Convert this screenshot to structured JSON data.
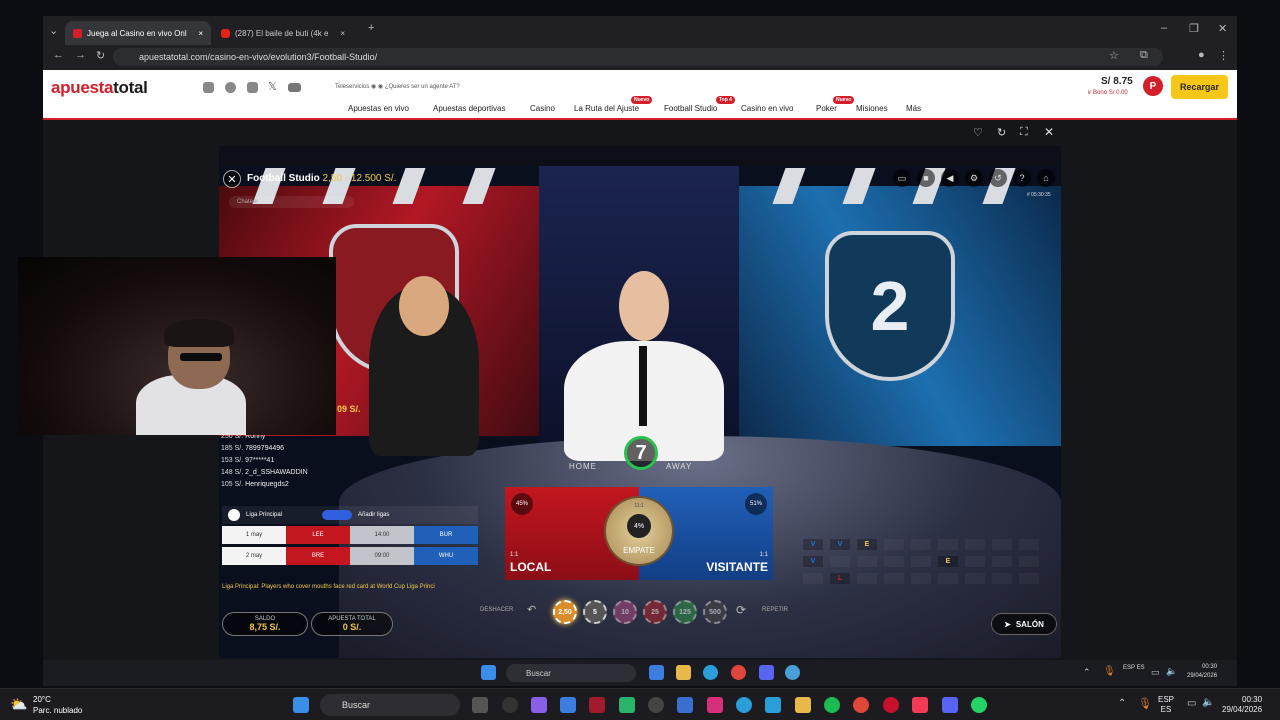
{
  "browser": {
    "tabs": [
      {
        "label": "Juega al Casino en vivo Onl"
      },
      {
        "label": "(287) El baile de buti (4k e"
      }
    ],
    "url": "apuestatotal.com/casino-en-vivo/evolution3/Football-Studio/"
  },
  "site": {
    "logo_part1": "apuesta",
    "logo_part2": "total",
    "service_line": "Teleservicios  ◉ ◉  ¿Quieres ser un agente AT?",
    "nav": [
      {
        "label": "Apuestas en vivo"
      },
      {
        "label": "Apuestas deportivas"
      },
      {
        "label": "Casino"
      },
      {
        "label": "La Ruta del Ajuste",
        "badge": "Nuevo"
      },
      {
        "label": "Football Studio",
        "badge": "Top 4"
      },
      {
        "label": "Casino en vivo"
      },
      {
        "label": "Poker",
        "badge": "Nuevo"
      },
      {
        "label": "Misiones"
      },
      {
        "label": "Más"
      }
    ],
    "balance": "S/ 8.75",
    "bono": "∨ Bono S/  0.00",
    "avatar": "P",
    "recargar": "Recargar"
  },
  "game": {
    "title": "Football Studio",
    "limits": "2,50 - 12.500 S/.",
    "chat_placeholder": "Chatear",
    "game_id": "# 05:30:35",
    "timer": "7",
    "home": "HOME",
    "away": "AWAY",
    "shield_right": "2",
    "floating_amount": "09 S/.",
    "winners": [
      {
        "amt": "250 S/.",
        "name": "Ronny"
      },
      {
        "amt": "185 S/.",
        "name": "7899794496"
      },
      {
        "amt": "153 S/.",
        "name": "97*****41"
      },
      {
        "amt": "148 S/.",
        "name": "2_d_SSHAWADDIN"
      },
      {
        "amt": "105 S/.",
        "name": "Henriquegds2"
      }
    ],
    "local": {
      "label": "LOCAL",
      "odds": "1:1",
      "pct": "45%"
    },
    "visitante": {
      "label": "VISITANTE",
      "odds": "1:1",
      "pct": "51%"
    },
    "empate": {
      "label": "EMPATE",
      "odds": "11:1",
      "pct": "4%"
    },
    "league": {
      "name": "Liga Principal",
      "add_league": "Añadir ligas",
      "matches": [
        {
          "date": "1 may",
          "home": "LEE",
          "time": "14:00",
          "away": "BUR"
        },
        {
          "date": "2 may",
          "home": "BRE",
          "time": "09:00",
          "away": "WHU"
        }
      ],
      "ticker": "Liga Principal:  Players who cover mouths face red card at World Cup    Liga Princi"
    },
    "saldo_label": "SALDO",
    "saldo_value": "8,75 S/.",
    "apuesta_label": "APUESTA TOTAL",
    "apuesta_value": "0 S/.",
    "deshacer": "DESHACER",
    "repetir": "REPETIR",
    "chips": [
      "2,50",
      "5",
      "10",
      "25",
      "125",
      "500"
    ],
    "salon": "SALÓN",
    "road": [
      [
        "V",
        "V",
        "E",
        "",
        "",
        "",
        "",
        "",
        ""
      ],
      [
        "V",
        "",
        "",
        "",
        "",
        "E",
        "",
        "",
        ""
      ],
      [
        "",
        "L",
        "",
        "",
        "",
        "",
        "",
        "",
        ""
      ]
    ]
  },
  "inner_taskbar": {
    "search": "Buscar",
    "lang": "ESP\nES",
    "time": "00:30",
    "date": "29/04/2026"
  },
  "taskbar": {
    "temp": "20°C",
    "weather": "Parc. nublado",
    "search": "Buscar",
    "lang1": "ESP",
    "lang2": "ES",
    "time": "00:30",
    "date": "29/04/2026"
  },
  "colors": {
    "brand_red": "#d21f2a",
    "recargar_yellow": "#f6c619",
    "local_red": "#c3161f",
    "visit_blue": "#2160b8",
    "timer_green": "#27c24c"
  }
}
